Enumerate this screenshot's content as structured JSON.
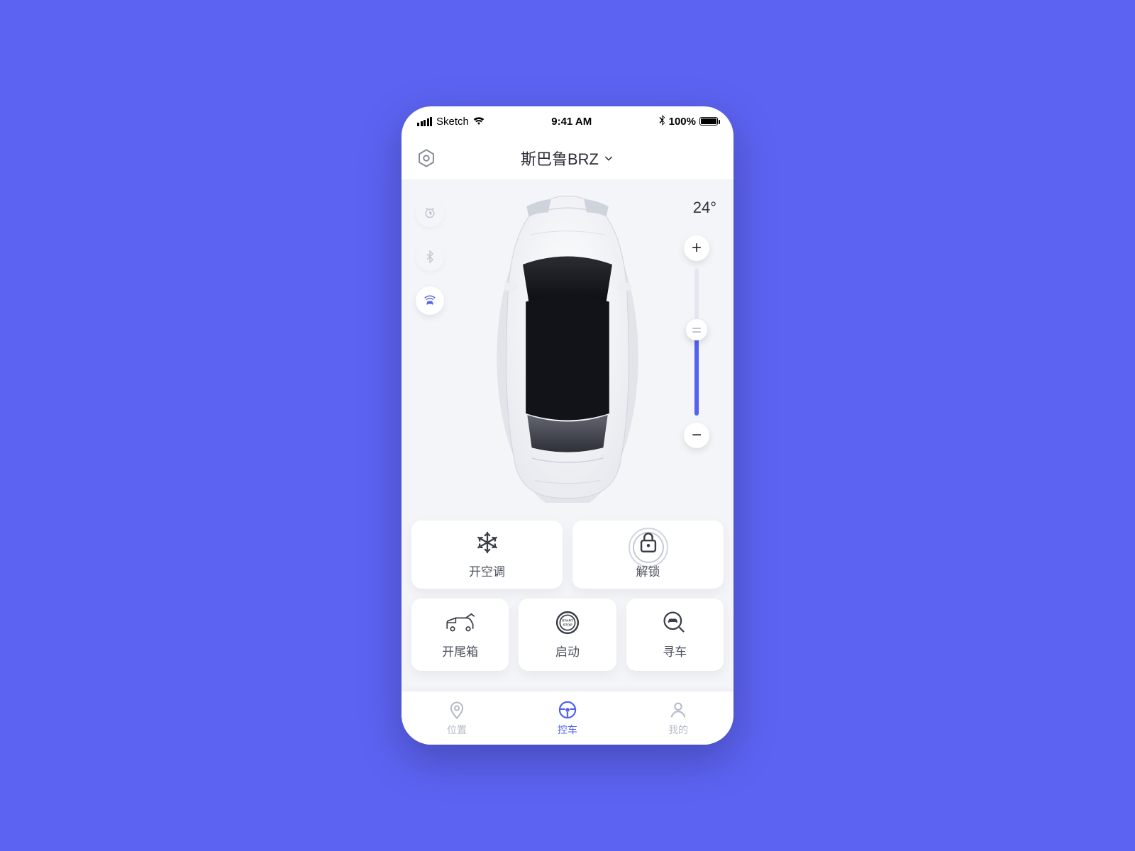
{
  "status_bar": {
    "carrier": "Sketch",
    "time": "9:41 AM",
    "battery_text": "100%"
  },
  "header": {
    "title": "斯巴鲁BRZ"
  },
  "stage": {
    "temperature": "24°"
  },
  "controls": {
    "ac_label": "开空调",
    "unlock_label": "解锁",
    "trunk_label": "开尾箱",
    "start_label": "启动",
    "find_label": "寻车",
    "start_inner_text": "START\nSTOP"
  },
  "bottom_nav": {
    "location_label": "位置",
    "control_label": "控车",
    "profile_label": "我的"
  },
  "colors": {
    "background": "#5c63f2",
    "accent": "#5363f0",
    "muted": "#b7bbc8"
  }
}
